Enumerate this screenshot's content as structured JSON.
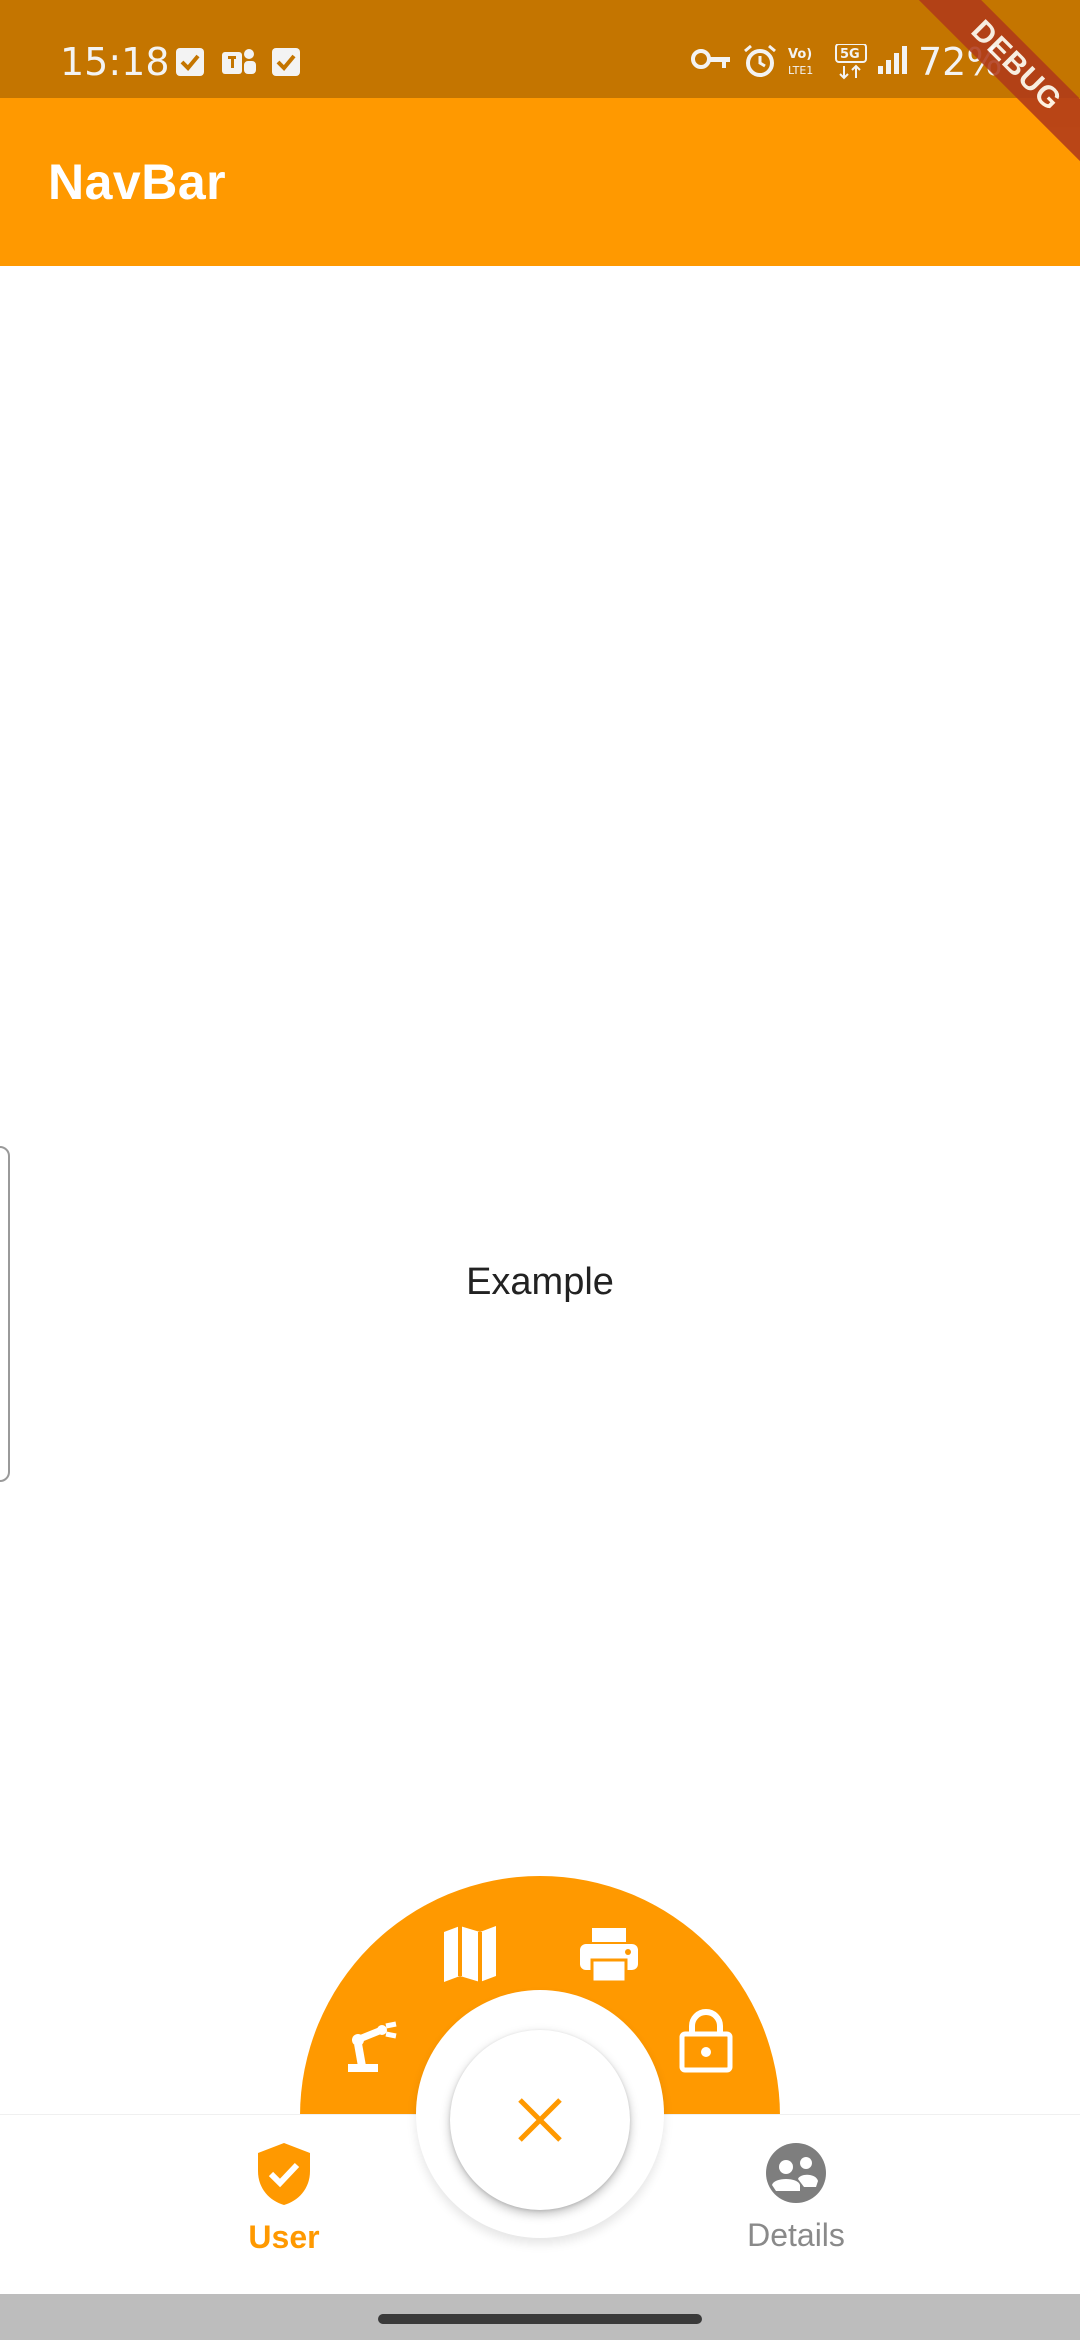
{
  "status_bar": {
    "time": "15:18",
    "battery": "72%",
    "left_icons": [
      "check-square-icon",
      "teams-icon",
      "check-square-icon"
    ],
    "right_icons": [
      "key-icon",
      "alarm-icon",
      "volte-icon",
      "5g-icon",
      "signal-icon"
    ]
  },
  "app_bar": {
    "title": "NavBar"
  },
  "debug_banner": {
    "label": "DEBUG"
  },
  "main": {
    "text": "Example"
  },
  "radial_menu": {
    "items": [
      "robot-arm-icon",
      "map-icon",
      "printer-icon",
      "lock-icon"
    ]
  },
  "fab": {
    "icon": "close-icon"
  },
  "bottom_nav": {
    "items": [
      {
        "label": "User",
        "icon": "shield-check-icon",
        "active": true
      },
      {
        "label": "Details",
        "icon": "group-icon",
        "active": false
      }
    ]
  },
  "colors": {
    "accent": "#ff9900",
    "status_bar": "#c47500",
    "inactive": "#8a8a8a"
  }
}
